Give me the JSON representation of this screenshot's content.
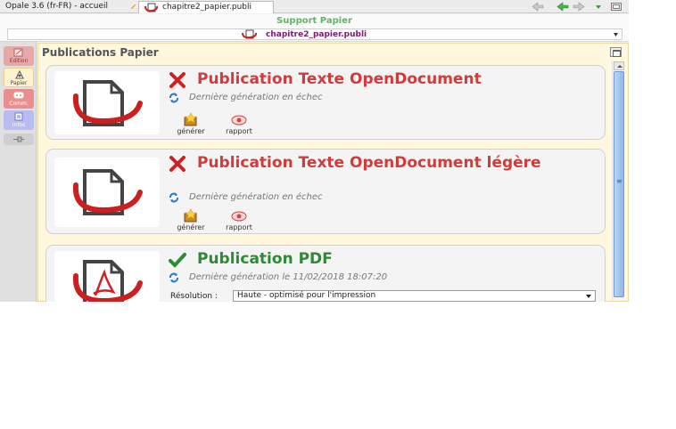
{
  "tabs": [
    {
      "label": "Opale 3.6 (fr-FR) - accueil"
    },
    {
      "label": "chapitre2_papier.publi"
    }
  ],
  "support": {
    "title": "Support Papier",
    "selected": "chapitre2_papier.publi"
  },
  "sidebar": {
    "items": [
      {
        "label": "Edition"
      },
      {
        "label": "Papier"
      },
      {
        "label": "Comm."
      },
      {
        "label": "Infos"
      }
    ]
  },
  "panel": {
    "title": "Publications Papier"
  },
  "publications": [
    {
      "title": "Publication Texte OpenDocument",
      "status": "error",
      "generation": "Dernière génération en échec",
      "actions": [
        "générer",
        "rapport"
      ]
    },
    {
      "title": "Publication Texte OpenDocument légère",
      "status": "error",
      "generation": "Dernière génération en échec",
      "actions": [
        "générer",
        "rapport"
      ]
    },
    {
      "title": "Publication PDF",
      "status": "success",
      "generation": "Dernière génération le 11/02/2018 18:07:20",
      "resolution_label": "Résolution :",
      "resolution_value": "Haute - optimisé pour l'impression"
    }
  ],
  "colors": {
    "error": "#d33b3b",
    "success": "#2d8a35",
    "support_title": "#5cb85c",
    "publi_name": "#7a1a6a",
    "panel_bg": "#fff8df"
  }
}
